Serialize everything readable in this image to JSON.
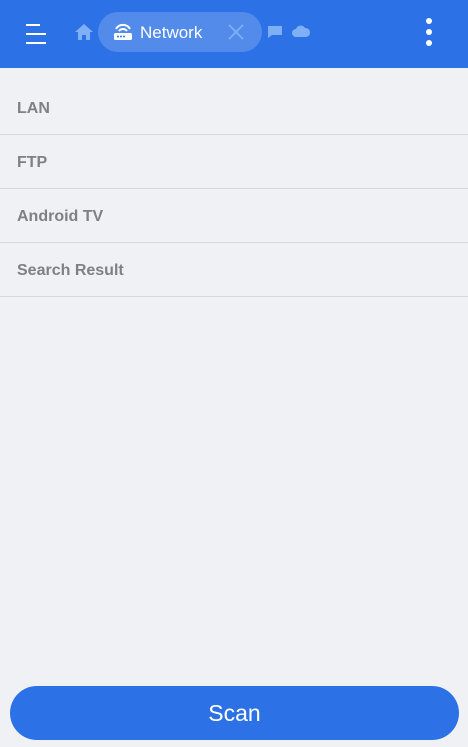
{
  "header": {
    "tab_label": "Network",
    "background_color": "#2c72e6",
    "icons": [
      "menu-icon",
      "home-icon",
      "router-icon",
      "close-icon",
      "chat-icon",
      "cloud-icon",
      "more-vert-icon"
    ]
  },
  "list": {
    "items": [
      {
        "label": "LAN"
      },
      {
        "label": "FTP"
      },
      {
        "label": "Android TV"
      },
      {
        "label": "Search Result"
      }
    ]
  },
  "footer": {
    "scan_label": "Scan"
  }
}
